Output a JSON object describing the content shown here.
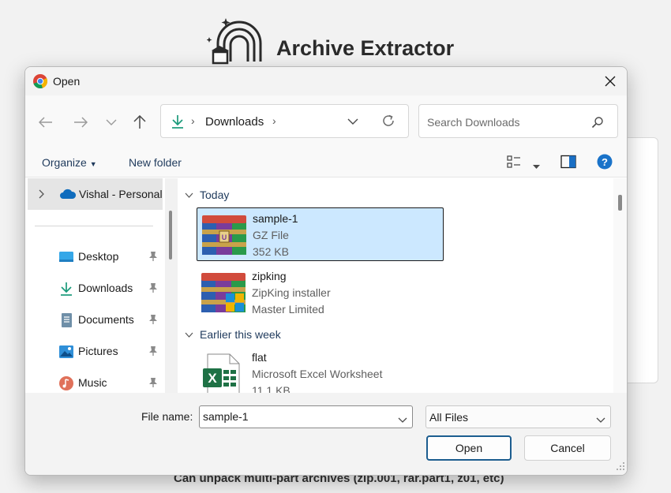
{
  "background": {
    "app_title": "Archive Extractor",
    "footer_text": "Can unpack multi-part archives (zip.001, rar.part1, z01, etc)"
  },
  "dialog": {
    "title": "Open",
    "address": {
      "location": "Downloads"
    },
    "search": {
      "placeholder": "Search Downloads"
    },
    "toolbar": {
      "organize_label": "Organize",
      "new_folder_label": "New folder"
    },
    "sidebar": {
      "onedrive_label": "Vishal - Personal",
      "items": [
        {
          "label": "Desktop",
          "icon": "desktop-icon"
        },
        {
          "label": "Downloads",
          "icon": "download-icon"
        },
        {
          "label": "Documents",
          "icon": "documents-icon"
        },
        {
          "label": "Pictures",
          "icon": "pictures-icon"
        },
        {
          "label": "Music",
          "icon": "music-icon"
        }
      ]
    },
    "groups": [
      {
        "label": "Today",
        "files": [
          {
            "name": "sample-1",
            "type": "GZ File",
            "size": "352 KB",
            "icon": "winrar-archive-icon",
            "selected": true
          },
          {
            "name": "zipking",
            "type": "ZipKing installer",
            "size": "Master Limited",
            "icon": "winrar-installer-icon",
            "selected": false
          }
        ]
      },
      {
        "label": "Earlier this week",
        "files": [
          {
            "name": "flat",
            "type": "Microsoft Excel Worksheet",
            "size": "11.1 KB",
            "icon": "excel-icon",
            "selected": false
          }
        ]
      }
    ],
    "file_name_label": "File name:",
    "file_name_value": "sample-1",
    "file_type_value": "All Files",
    "open_label": "Open",
    "cancel_label": "Cancel"
  },
  "colors": {
    "selection_bg": "#cce8ff",
    "accent_blue": "#1c5d8f",
    "link_text": "#1f3a5c"
  }
}
